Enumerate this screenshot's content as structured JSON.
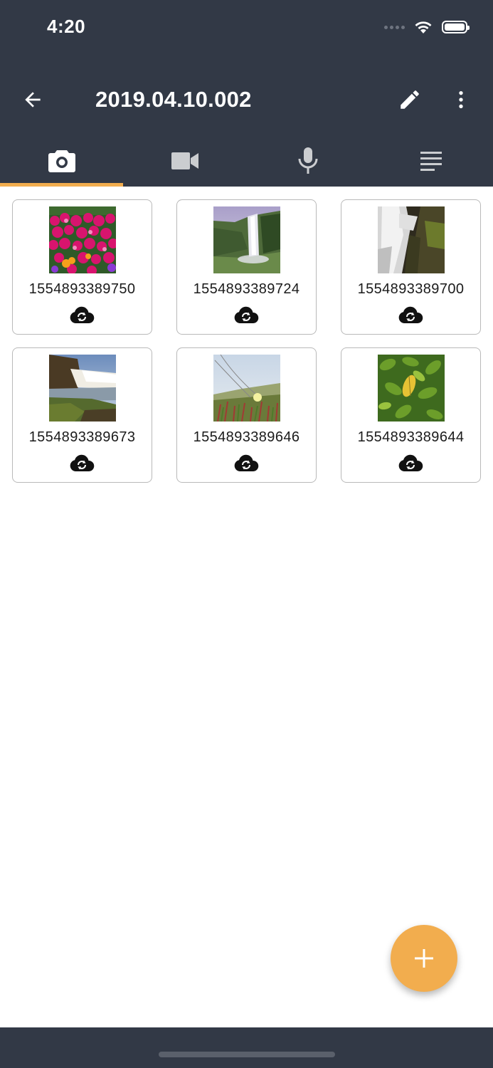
{
  "status_bar": {
    "time": "4:20"
  },
  "toolbar": {
    "title": "2019.04.10.002",
    "back_icon": "arrow-left-icon",
    "edit_icon": "pencil-icon",
    "more_icon": "more-vertical-icon"
  },
  "tabs": [
    {
      "icon": "camera-icon",
      "selected": true
    },
    {
      "icon": "video-icon",
      "selected": false
    },
    {
      "icon": "microphone-icon",
      "selected": false
    },
    {
      "icon": "notes-icon",
      "selected": false
    }
  ],
  "photos": [
    {
      "label": "1554893389750",
      "thumbnail": "pink-flowers"
    },
    {
      "label": "1554893389724",
      "thumbnail": "waterfall-cliff"
    },
    {
      "label": "1554893389700",
      "thumbnail": "waterfall-close"
    },
    {
      "label": "1554893389673",
      "thumbnail": "waterfall-lake"
    },
    {
      "label": "1554893389646",
      "thumbnail": "grass-flower"
    },
    {
      "label": "1554893389644",
      "thumbnail": "green-leaves"
    }
  ],
  "colors": {
    "header": "#323946",
    "accent": "#f2ad4e"
  }
}
